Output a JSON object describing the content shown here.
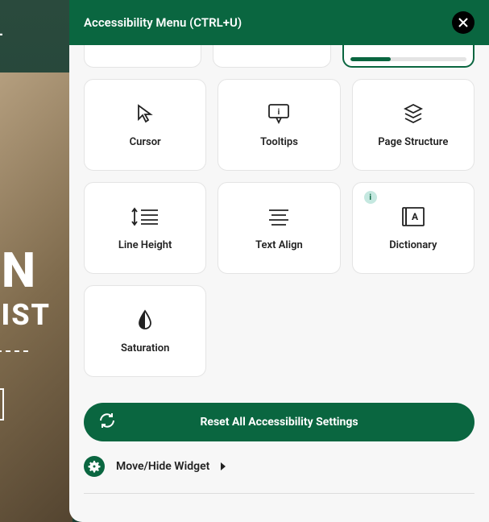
{
  "background": {
    "nav_text": "BL",
    "headline1": "İN",
    "headline2": "LIST"
  },
  "panel": {
    "title": "Accessibility Menu (CTRL+U)"
  },
  "cards": {
    "cursor": "Cursor",
    "tooltips": "Tooltips",
    "page_structure": "Page Structure",
    "line_height": "Line Height",
    "text_align": "Text Align",
    "dictionary": "Dictionary",
    "saturation": "Saturation"
  },
  "info_badge": "i",
  "reset": {
    "label": "Reset All Accessibility Settings"
  },
  "move_hide": {
    "label": "Move/Hide Widget"
  }
}
